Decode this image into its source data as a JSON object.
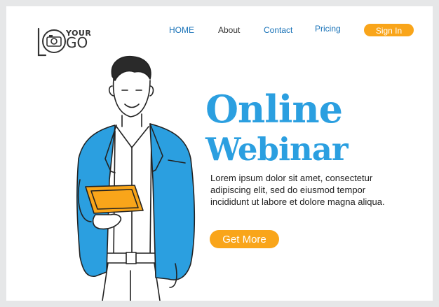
{
  "logo": {
    "line1": "YOUR",
    "line2": "GO"
  },
  "nav": {
    "home": "HOME",
    "about": "About",
    "contact": "Contact",
    "pricing": "Pricing",
    "signin": "Sign In"
  },
  "hero": {
    "title_line1": "Online",
    "title_line2": "Webinar",
    "description": "Lorem ipsum dolor sit amet, consectetur adipiscing elit, sed do eiusmod tempor incididunt ut labore et dolore magna aliqua.",
    "cta": "Get More"
  },
  "colors": {
    "accent_blue": "#2b9fe0",
    "accent_orange": "#f9a51a",
    "nav_blue": "#1a73b8",
    "background": "#e6e7e8"
  },
  "icons": {
    "logo": "camera-icon"
  }
}
